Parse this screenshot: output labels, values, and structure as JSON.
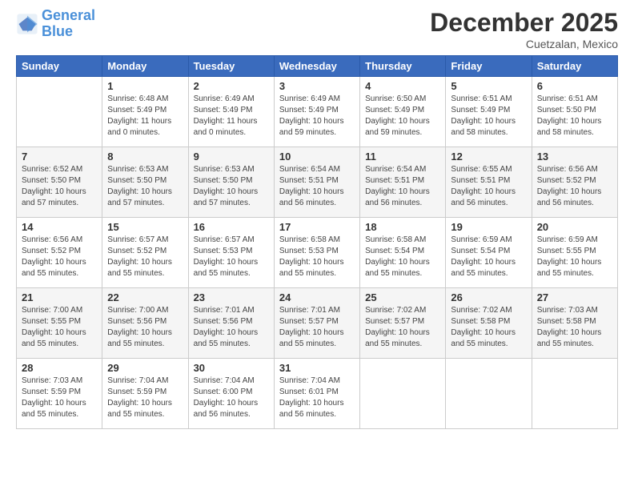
{
  "logo": {
    "line1": "General",
    "line2": "Blue"
  },
  "title": "December 2025",
  "subtitle": "Cuetzalan, Mexico",
  "weekdays": [
    "Sunday",
    "Monday",
    "Tuesday",
    "Wednesday",
    "Thursday",
    "Friday",
    "Saturday"
  ],
  "weeks": [
    [
      {
        "day": "",
        "info": ""
      },
      {
        "day": "1",
        "info": "Sunrise: 6:48 AM\nSunset: 5:49 PM\nDaylight: 11 hours\nand 0 minutes."
      },
      {
        "day": "2",
        "info": "Sunrise: 6:49 AM\nSunset: 5:49 PM\nDaylight: 11 hours\nand 0 minutes."
      },
      {
        "day": "3",
        "info": "Sunrise: 6:49 AM\nSunset: 5:49 PM\nDaylight: 10 hours\nand 59 minutes."
      },
      {
        "day": "4",
        "info": "Sunrise: 6:50 AM\nSunset: 5:49 PM\nDaylight: 10 hours\nand 59 minutes."
      },
      {
        "day": "5",
        "info": "Sunrise: 6:51 AM\nSunset: 5:49 PM\nDaylight: 10 hours\nand 58 minutes."
      },
      {
        "day": "6",
        "info": "Sunrise: 6:51 AM\nSunset: 5:50 PM\nDaylight: 10 hours\nand 58 minutes."
      }
    ],
    [
      {
        "day": "7",
        "info": "Sunrise: 6:52 AM\nSunset: 5:50 PM\nDaylight: 10 hours\nand 57 minutes."
      },
      {
        "day": "8",
        "info": "Sunrise: 6:53 AM\nSunset: 5:50 PM\nDaylight: 10 hours\nand 57 minutes."
      },
      {
        "day": "9",
        "info": "Sunrise: 6:53 AM\nSunset: 5:50 PM\nDaylight: 10 hours\nand 57 minutes."
      },
      {
        "day": "10",
        "info": "Sunrise: 6:54 AM\nSunset: 5:51 PM\nDaylight: 10 hours\nand 56 minutes."
      },
      {
        "day": "11",
        "info": "Sunrise: 6:54 AM\nSunset: 5:51 PM\nDaylight: 10 hours\nand 56 minutes."
      },
      {
        "day": "12",
        "info": "Sunrise: 6:55 AM\nSunset: 5:51 PM\nDaylight: 10 hours\nand 56 minutes."
      },
      {
        "day": "13",
        "info": "Sunrise: 6:56 AM\nSunset: 5:52 PM\nDaylight: 10 hours\nand 56 minutes."
      }
    ],
    [
      {
        "day": "14",
        "info": "Sunrise: 6:56 AM\nSunset: 5:52 PM\nDaylight: 10 hours\nand 55 minutes."
      },
      {
        "day": "15",
        "info": "Sunrise: 6:57 AM\nSunset: 5:52 PM\nDaylight: 10 hours\nand 55 minutes."
      },
      {
        "day": "16",
        "info": "Sunrise: 6:57 AM\nSunset: 5:53 PM\nDaylight: 10 hours\nand 55 minutes."
      },
      {
        "day": "17",
        "info": "Sunrise: 6:58 AM\nSunset: 5:53 PM\nDaylight: 10 hours\nand 55 minutes."
      },
      {
        "day": "18",
        "info": "Sunrise: 6:58 AM\nSunset: 5:54 PM\nDaylight: 10 hours\nand 55 minutes."
      },
      {
        "day": "19",
        "info": "Sunrise: 6:59 AM\nSunset: 5:54 PM\nDaylight: 10 hours\nand 55 minutes."
      },
      {
        "day": "20",
        "info": "Sunrise: 6:59 AM\nSunset: 5:55 PM\nDaylight: 10 hours\nand 55 minutes."
      }
    ],
    [
      {
        "day": "21",
        "info": "Sunrise: 7:00 AM\nSunset: 5:55 PM\nDaylight: 10 hours\nand 55 minutes."
      },
      {
        "day": "22",
        "info": "Sunrise: 7:00 AM\nSunset: 5:56 PM\nDaylight: 10 hours\nand 55 minutes."
      },
      {
        "day": "23",
        "info": "Sunrise: 7:01 AM\nSunset: 5:56 PM\nDaylight: 10 hours\nand 55 minutes."
      },
      {
        "day": "24",
        "info": "Sunrise: 7:01 AM\nSunset: 5:57 PM\nDaylight: 10 hours\nand 55 minutes."
      },
      {
        "day": "25",
        "info": "Sunrise: 7:02 AM\nSunset: 5:57 PM\nDaylight: 10 hours\nand 55 minutes."
      },
      {
        "day": "26",
        "info": "Sunrise: 7:02 AM\nSunset: 5:58 PM\nDaylight: 10 hours\nand 55 minutes."
      },
      {
        "day": "27",
        "info": "Sunrise: 7:03 AM\nSunset: 5:58 PM\nDaylight: 10 hours\nand 55 minutes."
      }
    ],
    [
      {
        "day": "28",
        "info": "Sunrise: 7:03 AM\nSunset: 5:59 PM\nDaylight: 10 hours\nand 55 minutes."
      },
      {
        "day": "29",
        "info": "Sunrise: 7:04 AM\nSunset: 5:59 PM\nDaylight: 10 hours\nand 55 minutes."
      },
      {
        "day": "30",
        "info": "Sunrise: 7:04 AM\nSunset: 6:00 PM\nDaylight: 10 hours\nand 56 minutes."
      },
      {
        "day": "31",
        "info": "Sunrise: 7:04 AM\nSunset: 6:01 PM\nDaylight: 10 hours\nand 56 minutes."
      },
      {
        "day": "",
        "info": ""
      },
      {
        "day": "",
        "info": ""
      },
      {
        "day": "",
        "info": ""
      }
    ]
  ]
}
